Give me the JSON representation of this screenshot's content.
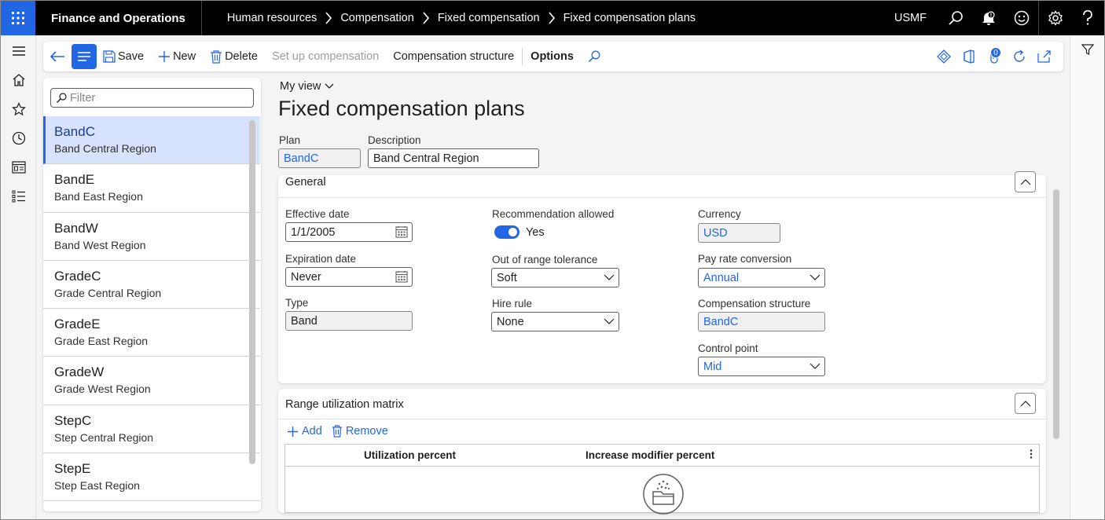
{
  "topbar": {
    "app_name": "Finance and Operations",
    "breadcrumbs": [
      "Human resources",
      "Compensation",
      "Fixed compensation",
      "Fixed compensation plans"
    ],
    "company": "USMF",
    "icons": [
      "search-icon",
      "notifications-icon",
      "feedback-smiley-icon",
      "settings-icon",
      "help-icon"
    ]
  },
  "actionpane": {
    "save": "Save",
    "new": "New",
    "delete": "Delete",
    "setup_compensation": "Set up compensation",
    "compensation_structure": "Compensation structure",
    "options": "Options",
    "attachments_count": "0"
  },
  "list": {
    "filter_placeholder": "Filter",
    "items": [
      {
        "title": "BandC",
        "subtitle": "Band Central Region"
      },
      {
        "title": "BandE",
        "subtitle": "Band East Region"
      },
      {
        "title": "BandW",
        "subtitle": "Band West Region"
      },
      {
        "title": "GradeC",
        "subtitle": "Grade Central Region"
      },
      {
        "title": "GradeE",
        "subtitle": "Grade East Region"
      },
      {
        "title": "GradeW",
        "subtitle": "Grade West Region"
      },
      {
        "title": "StepC",
        "subtitle": "Step Central Region"
      },
      {
        "title": "StepE",
        "subtitle": "Step East Region"
      }
    ]
  },
  "page": {
    "view": "My view",
    "title": "Fixed compensation plans",
    "plan_label": "Plan",
    "plan_value": "BandC",
    "description_label": "Description",
    "description_value": "Band Central Region"
  },
  "general": {
    "heading": "General",
    "effective_date_label": "Effective date",
    "effective_date": "1/1/2005",
    "expiration_date_label": "Expiration date",
    "expiration_date": "Never",
    "type_label": "Type",
    "type": "Band",
    "recommendation_label": "Recommendation allowed",
    "recommendation": "Yes",
    "tolerance_label": "Out of range tolerance",
    "tolerance": "Soft",
    "hire_rule_label": "Hire rule",
    "hire_rule": "None",
    "currency_label": "Currency",
    "currency": "USD",
    "pay_rate_label": "Pay rate conversion",
    "pay_rate": "Annual",
    "structure_label": "Compensation structure",
    "structure": "BandC",
    "control_point_label": "Control point",
    "control_point": "Mid"
  },
  "matrix": {
    "heading": "Range utilization matrix",
    "add": "Add",
    "remove": "Remove",
    "col_utilization": "Utilization percent",
    "col_modifier": "Increase modifier percent"
  }
}
